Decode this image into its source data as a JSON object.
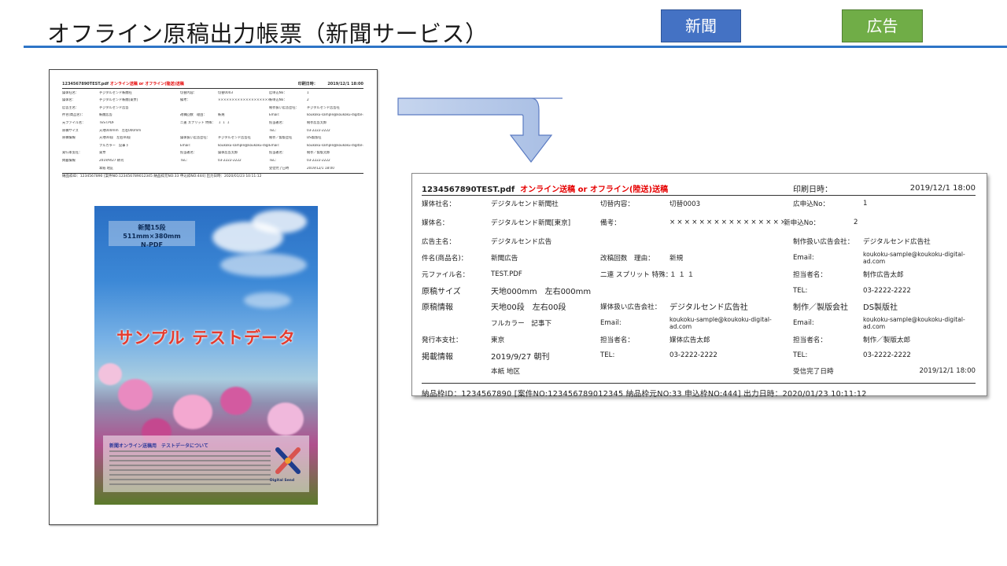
{
  "header": {
    "title": "オフライン原稿出力帳票（新聞サービス）",
    "tag_news": "新聞",
    "tag_ad": "広告",
    "accent": "#2e75c7"
  },
  "report": {
    "filename": "1234567890TEST.pdf",
    "send_type": "オンライン送稿 or オフライン(陸送)送稿",
    "print_label": "印刷日時：",
    "print_value": "2019/12/1 18:00",
    "rows": [
      [
        "媒体社名：",
        "デジタルセンド新聞社",
        "切替内容：",
        "切替0003",
        "広申込No：",
        "1"
      ],
      [
        "媒体名：",
        "デジタルセンド新聞[東京]",
        "備考：",
        "×××××××××××××××××××××",
        "新申込No：",
        "2"
      ],
      [
        "広告主名：",
        "デジタルセンド広告",
        "",
        "",
        "制作扱い広告会社：",
        "デジタルセンド広告社"
      ],
      [
        "件名(商品名)：",
        "新聞広告",
        "改稿回数　理由：",
        "新規",
        "Email:",
        "koukoku-sample@koukoku-digital-ad.com"
      ],
      [
        "元ファイル名：",
        "TEST.PDF",
        "二連 スプリット 特殊：",
        "１ １ １",
        "担当者名：",
        "制作広告太郎"
      ],
      [
        "原稿サイズ",
        "天地000mm　左右000mm",
        "",
        "",
        "TEL:",
        "03-2222-2222"
      ],
      [
        "原稿情報",
        "天地00段　左右00段",
        "媒体扱い広告会社：",
        "デジタルセンド広告社",
        "制作／製版会社",
        "DS製版社"
      ],
      [
        "",
        "フルカラー　記事下",
        "Email:",
        "koukoku-sample@koukoku-digital-ad.com",
        "Email:",
        "koukoku-sample@koukoku-digital-ad.com"
      ],
      [
        "発行本支社：",
        "東京",
        "担当者名：",
        "媒体広告太郎",
        "担当者名：",
        "制作／製版太郎"
      ],
      [
        "掲載情報",
        "2019/9/27 朝刊",
        "TEL:",
        "03-2222-2222",
        "TEL:",
        "03-2222-2222"
      ],
      [
        "",
        "本紙 地区",
        "",
        "",
        "受信完了日時",
        "2019/12/1 18:00"
      ]
    ],
    "footer": "納品枠ID：1234567890 [案件NO:123456789012345 納品枠元NO:33 申込枠NO:444] 出力日時：2020/01/23 10:11:12"
  },
  "poster": {
    "size_line1": "新聞15段 511mm×380mm",
    "size_line2": "N-PDF",
    "sample_text": "サンプル テストデータ",
    "box_title": "新聞オンライン送稿用　テストデータについて",
    "logo_text": "Digital Send"
  }
}
